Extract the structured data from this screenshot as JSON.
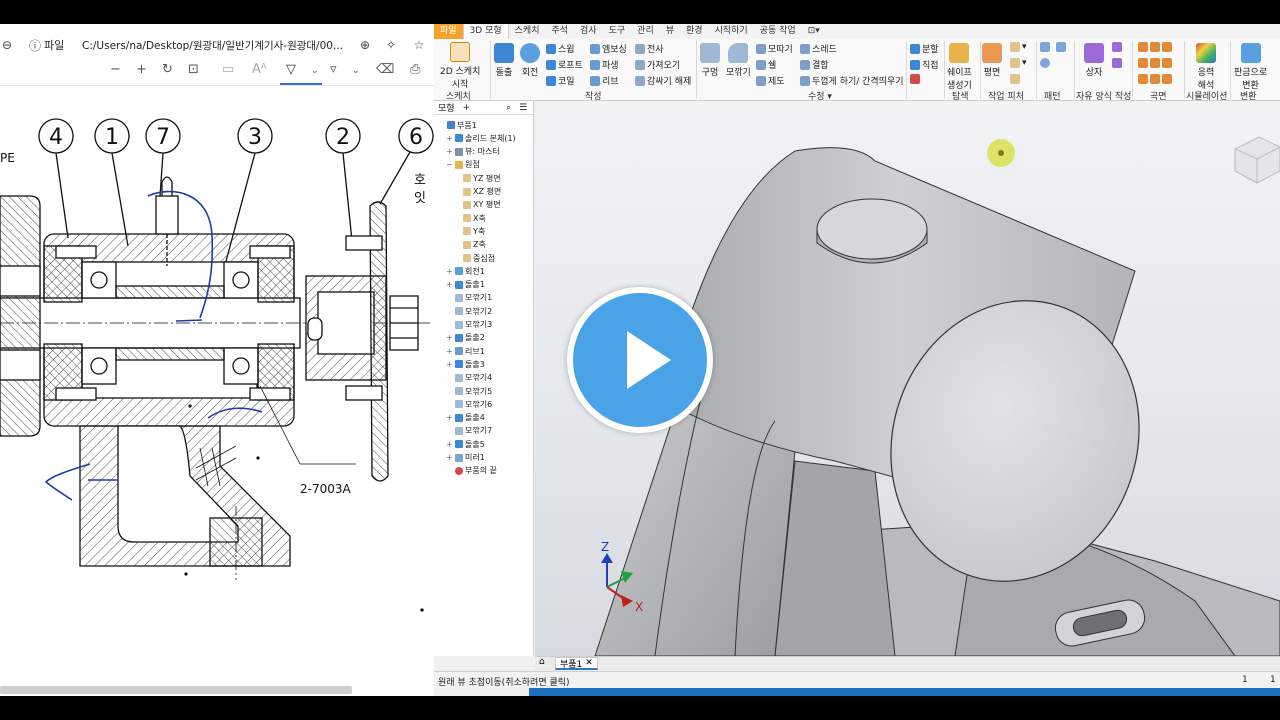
{
  "pdf": {
    "menu_label": "파일",
    "path": "C:/Users/na/Desktop/원광대/일반기계기사-원광대/00...",
    "balloons": [
      "4",
      "1",
      "7",
      "3",
      "2",
      "6"
    ],
    "edge_text_left": "PE",
    "edge_text_right_1": "호",
    "edge_text_right_2": "잇",
    "bearing_label": "2-7003A"
  },
  "ribbon": {
    "tabs": [
      "파일",
      "3D 모형",
      "스케치",
      "주석",
      "검사",
      "도구",
      "관리",
      "뷰",
      "환경",
      "시작하기",
      "공동 작업"
    ],
    "sketch": {
      "btn1": "2D 스케치",
      "btn2": "시작",
      "panel": "스케치"
    },
    "create": {
      "extrude": "돌출",
      "revolve": "회전",
      "sweep": "스윕",
      "loft": "로프트",
      "coil": "코일",
      "emboss": "엠보싱",
      "derive": "파생",
      "rib": "리브",
      "decal": "전사",
      "import": "가져오기",
      "unwrap": "감싸기 해제",
      "panel": "작성"
    },
    "modify": {
      "hole": "구멍",
      "fillet": "모깎기",
      "chamfer": "모따기",
      "shell": "쉘",
      "draft": "제도",
      "thread": "스레드",
      "combine": "결합",
      "thicken": "두껍게 하기/ 간격띄우기",
      "panel": "수정 ▾"
    },
    "split": "분할",
    "direct": "직접",
    "explore": {
      "btn1": "쉐이프",
      "btn2": "생성기",
      "panel": "탐색"
    },
    "work": {
      "btn": "평면",
      "panel": "작업 피처"
    },
    "pattern_panel": "패턴",
    "freeform": {
      "btn": "상자",
      "panel": "자유 양식 작성"
    },
    "surface_panel": "곡면",
    "sim": {
      "btn1": "응력",
      "btn2": "해석",
      "panel": "시뮬레이션"
    },
    "convert": {
      "btn1": "판금으로",
      "btn2": "변환",
      "panel": "변환"
    }
  },
  "browser": {
    "tab": "모형",
    "items": [
      {
        "label": "부품1"
      },
      {
        "label": "솔리드 본체(1)"
      },
      {
        "label": "뷰: 마스터"
      },
      {
        "label": "원점"
      },
      {
        "label": "YZ 평면"
      },
      {
        "label": "XZ 평면"
      },
      {
        "label": "XY 평면"
      },
      {
        "label": "X축"
      },
      {
        "label": "Y축"
      },
      {
        "label": "Z축"
      },
      {
        "label": "중심점"
      },
      {
        "label": "회전1"
      },
      {
        "label": "돌출1"
      },
      {
        "label": "모깎기1"
      },
      {
        "label": "모깎기2"
      },
      {
        "label": "모깎기3"
      },
      {
        "label": "돌출2"
      },
      {
        "label": "리브1"
      },
      {
        "label": "돌출3"
      },
      {
        "label": "모깎기4"
      },
      {
        "label": "모깎기5"
      },
      {
        "label": "모깎기6"
      },
      {
        "label": "돌출4"
      },
      {
        "label": "모깎기7"
      },
      {
        "label": "돌출5"
      },
      {
        "label": "미러1"
      },
      {
        "label": "부품의 끝"
      }
    ]
  },
  "viewport": {
    "triad": {
      "z": "Z",
      "x": "X"
    }
  },
  "doc_tab": "부품1",
  "status": {
    "text": "원래 뷰 초점이동(취소하려면 클릭)",
    "n1": "1",
    "n2": "1"
  },
  "colors": {
    "file_tab": "#f4a22b",
    "play": "#4aa3e6",
    "taskbar": "#1e6fc2"
  }
}
